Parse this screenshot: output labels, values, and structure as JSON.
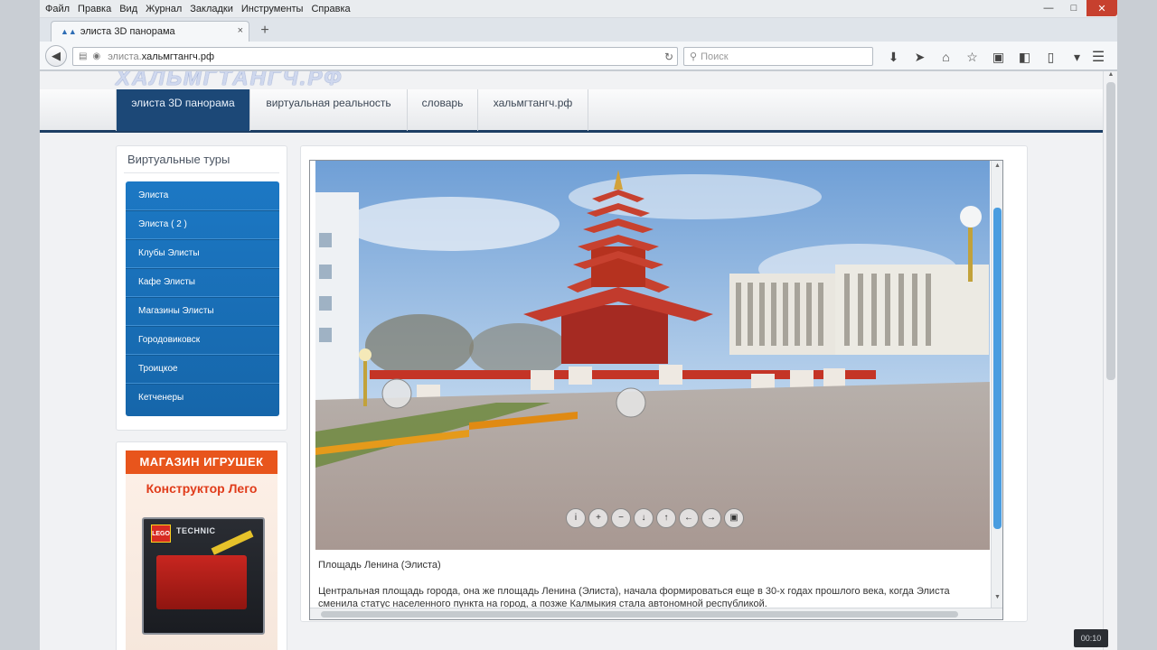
{
  "menubar": [
    "Файл",
    "Правка",
    "Вид",
    "Журнал",
    "Закладки",
    "Инструменты",
    "Справка"
  ],
  "window_controls": {
    "minimize": "—",
    "maximize": "□",
    "close": "✕"
  },
  "tab": {
    "title": "элиста 3D панорама",
    "close": "×",
    "new": "+"
  },
  "urlbar": {
    "prefix": "элиста.",
    "domain": "хальмгтангч.рф",
    "reload_icon": "reload-icon"
  },
  "searchbar": {
    "placeholder": "Поиск"
  },
  "toolbar_icons": [
    "download-icon",
    "send-icon",
    "home-icon",
    "star-icon",
    "pocket-icon",
    "extension-icon",
    "phone-icon",
    "dropdown-icon"
  ],
  "site": {
    "logo_text": "ХАЛЬМГТАНГЧ.РФ",
    "nav": [
      {
        "label": "элиста 3D панорама",
        "active": true
      },
      {
        "label": "виртуальная реальность",
        "active": false
      },
      {
        "label": "словарь",
        "active": false
      },
      {
        "label": "хальмгтангч.рф",
        "active": false
      }
    ],
    "sidebar": {
      "title": "Виртуальные туры",
      "items": [
        "Элиста",
        "Элиста ( 2 )",
        "Клубы Элисты",
        "Кафе Элисты",
        "Магазины Элисты",
        "Городовиковск",
        "Троицкое",
        "Кетченеры"
      ]
    },
    "ad": {
      "headline": "МАГАЗИН ИГРУШЕК",
      "subline": "Конструктор Лего",
      "brand": "LEGO",
      "series": "TECHNIC"
    },
    "panorama": {
      "controls": [
        "i",
        "+",
        "−",
        "↓",
        "↑",
        "←",
        "→",
        "▣"
      ],
      "caption": "Площадь Ленина (Элиста)",
      "description": "Центральная площадь города, она же площадь Ленина (Элиста), начала формироваться еще в 30-х годах прошлого века, когда Элиста сменила статус населенного пункта на город, а позже Калмыкия стала автономной республикой."
    }
  },
  "video_badge": "00:10",
  "colors": {
    "nav_active": "#1c4877",
    "sidebar_menu": "#1a70b8",
    "scroll_thumb": "#4a9de0",
    "ad_accent": "#e8551c"
  }
}
